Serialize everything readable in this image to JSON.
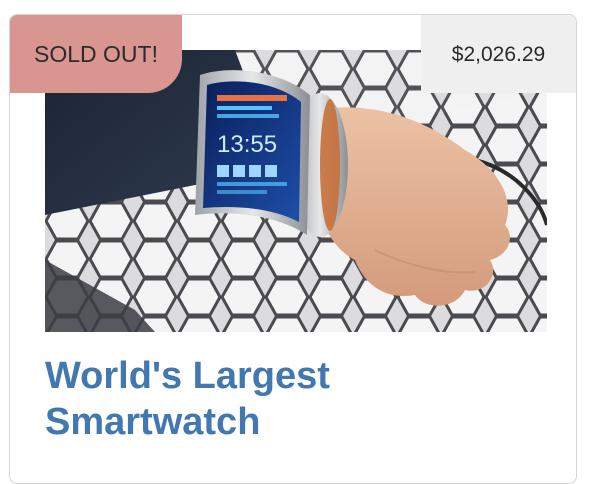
{
  "product": {
    "badge": "SOLD OUT!",
    "price": "$2,026.29",
    "title": "World's Largest Smartwatch",
    "image_alt": "flexible-wrist-display-photo"
  },
  "colors": {
    "badge_bg": "#d9958f",
    "price_bg": "#efefef",
    "title": "#4377b0",
    "border": "#d6d6d6"
  }
}
